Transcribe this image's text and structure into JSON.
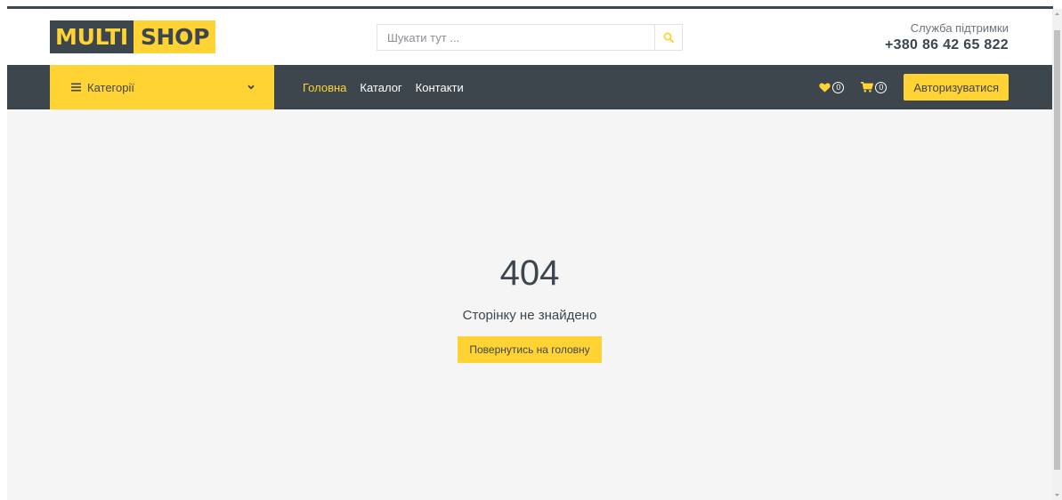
{
  "logo": {
    "part_a": "MULTI",
    "part_b": "SHOP"
  },
  "search": {
    "placeholder": "Шукати тут ...",
    "value": "",
    "icon": "search-icon"
  },
  "support": {
    "label": "Служба підтримки",
    "phone": "+380 86 42 65 822"
  },
  "navbar": {
    "categories_label": "Категорії",
    "links": [
      {
        "label": "Головна",
        "active": true
      },
      {
        "label": "Каталог",
        "active": false
      },
      {
        "label": "Контакти",
        "active": false
      }
    ],
    "wishlist_count": "0",
    "cart_count": "0",
    "login_label": "Авторизуватися"
  },
  "error": {
    "code": "404",
    "message": "Сторінку не знайдено",
    "home_button": "Повернутись на головну"
  },
  "colors": {
    "accent": "#FFD333",
    "dark": "#3D464D",
    "background": "#F5F5F5",
    "muted": "#6C757D"
  }
}
